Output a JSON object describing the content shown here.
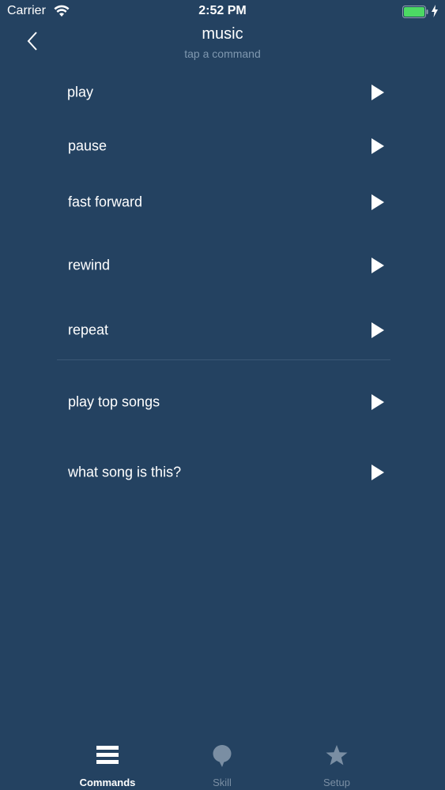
{
  "status_bar": {
    "carrier": "Carrier",
    "time": "2:52 PM",
    "battery_color": "#4cd964"
  },
  "header": {
    "title": "music",
    "subtitle": "tap a command"
  },
  "commands": [
    {
      "label": "play"
    },
    {
      "label": "pause"
    },
    {
      "label": "fast forward"
    },
    {
      "label": "rewind"
    },
    {
      "label": "repeat"
    },
    {
      "label": "play top songs"
    },
    {
      "label": "what song is this?"
    }
  ],
  "tabs": [
    {
      "label": "Commands",
      "icon": "list-icon",
      "active": true
    },
    {
      "label": "Skill",
      "icon": "speech-bubble-icon",
      "active": false
    },
    {
      "label": "Setup",
      "icon": "star-icon",
      "active": false
    }
  ],
  "colors": {
    "background": "#244261",
    "subtitle": "#7f98b0",
    "inactive_tab": "#7a8ea3"
  }
}
